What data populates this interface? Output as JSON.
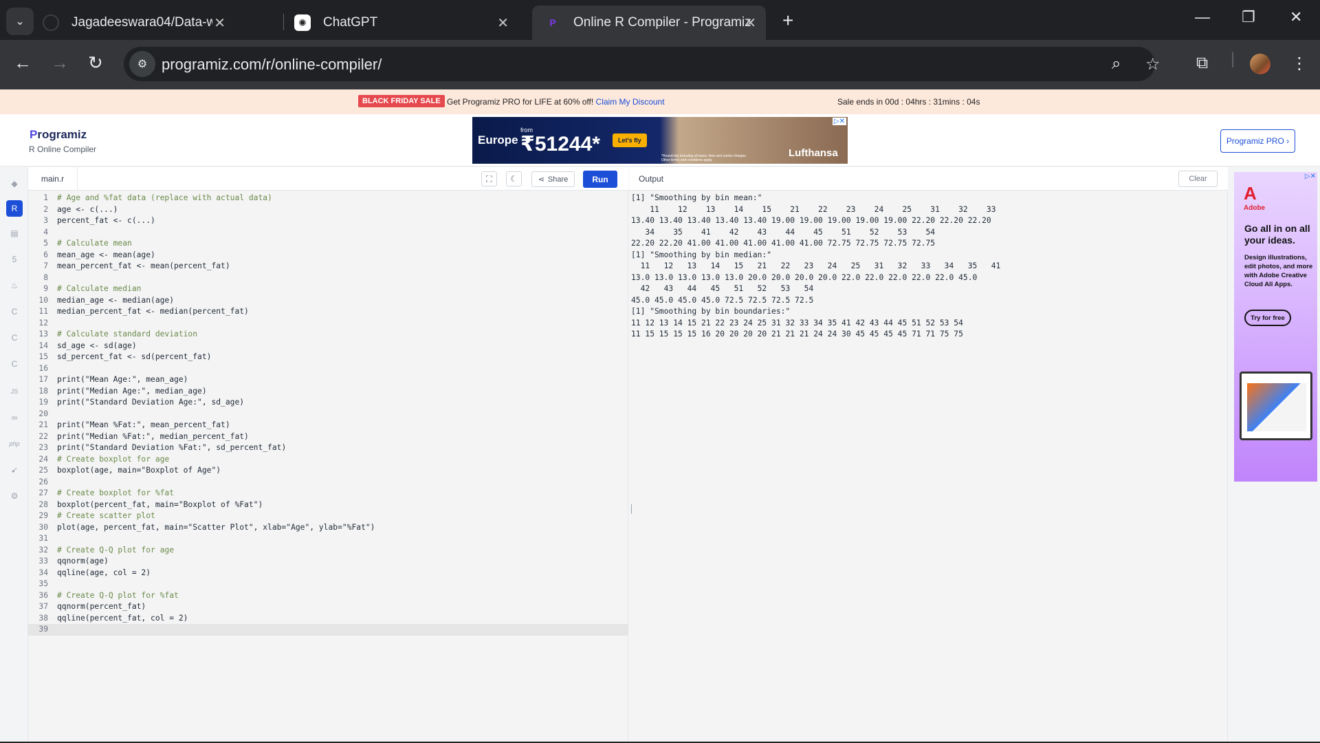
{
  "browser": {
    "tabs": [
      {
        "title": "Jagadeeswara04/Data-warehou",
        "active": false
      },
      {
        "title": "ChatGPT",
        "active": false
      },
      {
        "title": "Online R Compiler - Programiz",
        "active": true
      }
    ],
    "url": "programiz.com/r/online-compiler/"
  },
  "promo": {
    "badge": "BLACK FRIDAY SALE",
    "message": "Get Programiz PRO for LIFE at 60% off!",
    "link": "Claim My Discount",
    "timer": "Sale ends in 00d : 04hrs : 31mins : 04s"
  },
  "header": {
    "logo_p": "P",
    "logo_rest": "rogramiz",
    "subtitle": "R Online Compiler",
    "ad": {
      "dest": "Europe",
      "from": "from",
      "price": "₹51244*",
      "cta": "Let's fly",
      "brand": "Lufthansa",
      "fine": "*Round-trip including all taxes, fees and carrier charges. Other terms and conditions apply."
    },
    "pro_button": "Programiz PRO ›"
  },
  "editor": {
    "filename": "main.r",
    "share_label": "Share",
    "run_label": "Run",
    "lines": [
      "# Age and %fat data (replace with actual data)",
      "age <- c(...)",
      "percent_fat <- c(...)",
      "",
      "# Calculate mean",
      "mean_age <- mean(age)",
      "mean_percent_fat <- mean(percent_fat)",
      "",
      "# Calculate median",
      "median_age <- median(age)",
      "median_percent_fat <- median(percent_fat)",
      "",
      "# Calculate standard deviation",
      "sd_age <- sd(age)",
      "sd_percent_fat <- sd(percent_fat)",
      "",
      "print(\"Mean Age:\", mean_age)",
      "print(\"Median Age:\", median_age)",
      "print(\"Standard Deviation Age:\", sd_age)",
      "",
      "print(\"Mean %Fat:\", mean_percent_fat)",
      "print(\"Median %Fat:\", median_percent_fat)",
      "print(\"Standard Deviation %Fat:\", sd_percent_fat)",
      "# Create boxplot for age",
      "boxplot(age, main=\"Boxplot of Age\")",
      "",
      "# Create boxplot for %fat",
      "boxplot(percent_fat, main=\"Boxplot of %Fat\")",
      "# Create scatter plot",
      "plot(age, percent_fat, main=\"Scatter Plot\", xlab=\"Age\", ylab=\"%Fat\")",
      "",
      "# Create Q-Q plot for age",
      "qqnorm(age)",
      "qqline(age, col = 2)",
      "",
      "# Create Q-Q plot for %fat",
      "qqnorm(percent_fat)",
      "qqline(percent_fat, col = 2)",
      ""
    ]
  },
  "output": {
    "title": "Output",
    "clear_label": "Clear",
    "lines": [
      "[1] \"Smoothing by bin mean:\"",
      "    11    12    13    14    15    21    22    23    24    25    31    32    33",
      "13.40 13.40 13.40 13.40 13.40 19.00 19.00 19.00 19.00 19.00 22.20 22.20 22.20",
      "   34    35    41    42    43    44    45    51    52    53    54",
      "22.20 22.20 41.00 41.00 41.00 41.00 41.00 72.75 72.75 72.75 72.75",
      "[1] \"Smoothing by bin median:\"",
      "  11   12   13   14   15   21   22   23   24   25   31   32   33   34   35   41",
      "13.0 13.0 13.0 13.0 13.0 20.0 20.0 20.0 20.0 22.0 22.0 22.0 22.0 22.0 45.0",
      "  42   43   44   45   51   52   53   54",
      "45.0 45.0 45.0 45.0 72.5 72.5 72.5 72.5",
      "[1] \"Smoothing by bin boundaries:\"",
      "11 12 13 14 15 21 22 23 24 25 31 32 33 34 35 41 42 43 44 45 51 52 53 54",
      "11 15 15 15 15 16 20 20 20 20 21 21 21 24 24 30 45 45 45 45 71 71 75 75"
    ]
  },
  "side_ad": {
    "logo": "A",
    "brand": "Adobe",
    "headline": "Go all in on all your ideas.",
    "body": "Design illustrations, edit photos, and more with Adobe Creative Cloud All Apps.",
    "cta": "Try for free"
  },
  "rail_icons": [
    "python-icon",
    "r-icon",
    "sql-icon",
    "html-icon",
    "java-icon",
    "c-icon",
    "cpp-icon",
    "csharp-icon",
    "js-icon",
    "go-icon",
    "php-icon",
    "swift-icon",
    "rust-icon"
  ]
}
